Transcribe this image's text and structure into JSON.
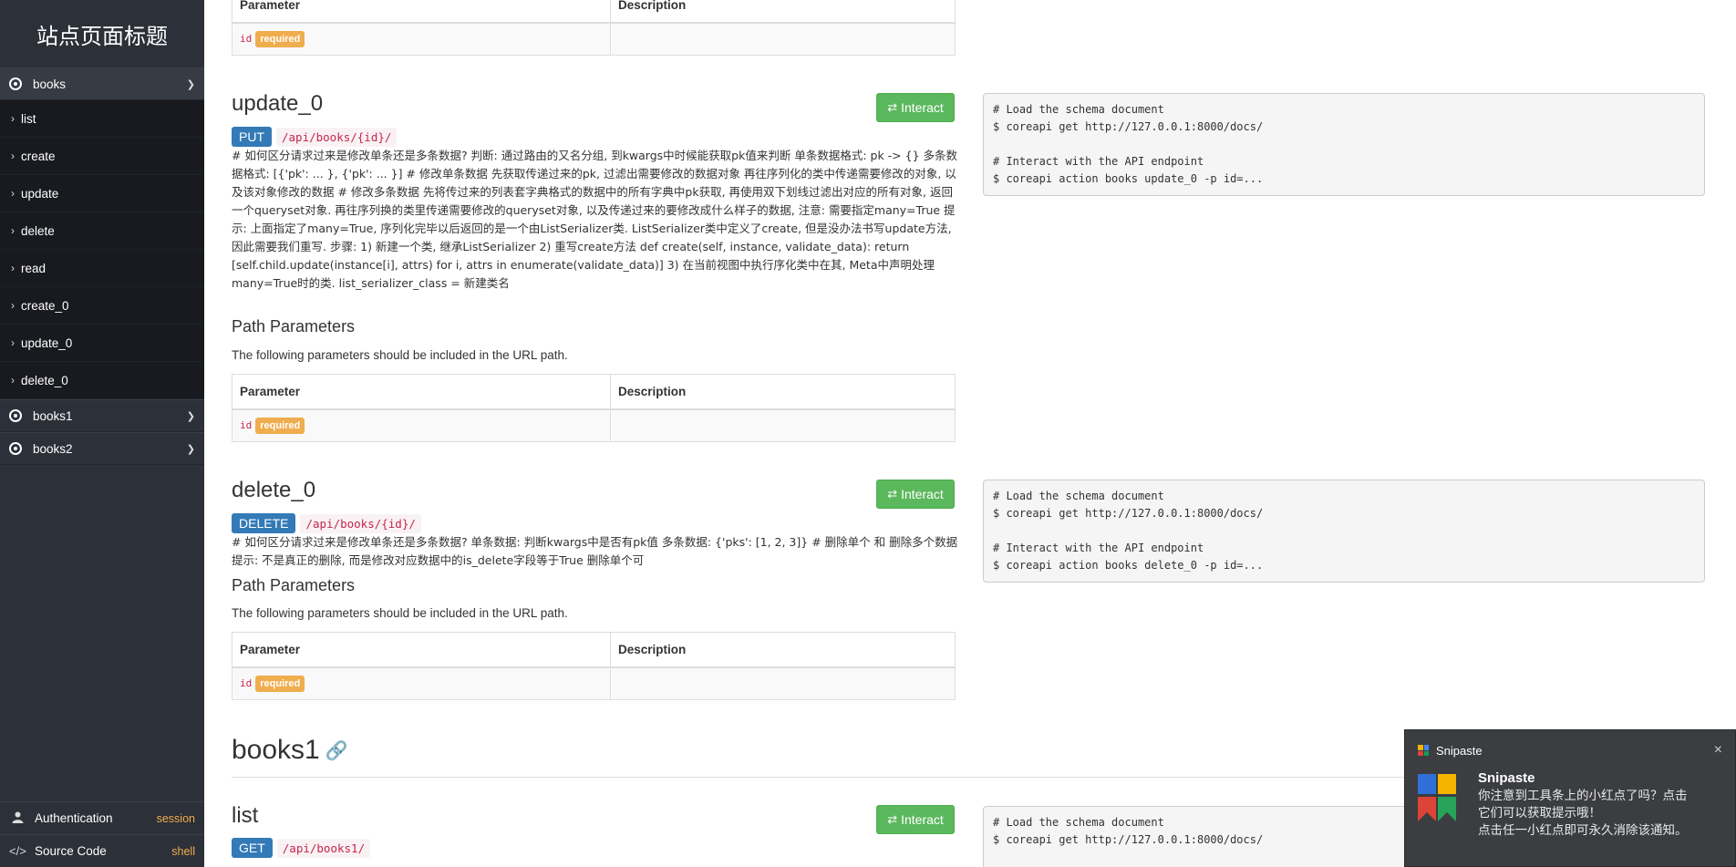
{
  "site_title": "站点页面标题",
  "sidebar": {
    "groups": [
      {
        "label": "books",
        "expanded": true
      },
      {
        "label": "books1",
        "expanded": false
      },
      {
        "label": "books2",
        "expanded": false
      }
    ],
    "books_items": [
      "list",
      "create",
      "update",
      "delete",
      "read",
      "create_0",
      "update_0",
      "delete_0"
    ],
    "bottom": {
      "auth_label": "Authentication",
      "auth_value": "session",
      "source_label": "Source Code",
      "source_value": "shell"
    }
  },
  "table": {
    "header_param": "Parameter",
    "header_desc": "Description",
    "param_name": "id",
    "required_label": "required"
  },
  "common": {
    "interact_label": "Interact",
    "path_params_title": "Path Parameters",
    "path_params_note": "The following parameters should be included in the URL path."
  },
  "update_0": {
    "title": "update_0",
    "method": "PUT",
    "path": "/api/books/{id}/",
    "description": "# 如何区分请求过来是修改单条还是多条数据? 判断: 通过路由的又名分组, 到kwargs中时候能获取pk值来判断 单条数据格式: pk -> {} 多条数据格式: [{'pk': ... }, {'pk': ... }] # 修改单条数据 先获取传递过来的pk, 过滤出需要修改的数据对象 再往序列化的类中传递需要修改的对象, 以及该对象修改的数据 # 修改多条数据 先将传过来的列表套字典格式的数据中的所有字典中pk获取, 再使用双下划线过滤出对应的所有对象, 返回一个queryset对象. 再往序列换的类里传递需要修改的queryset对象, 以及传递过来的要修改成什么样子的数据, 注意: 需要指定many=True 提示: 上面指定了many=True, 序列化完毕以后返回的是一个由ListSerializer类. ListSerializer类中定义了create, 但是没办法书写update方法, 因此需要我们重写. 步骤: 1) 新建一个类, 继承ListSerializer 2) 重写create方法 def create(self, instance, validate_data): return [self.child.update(instance[i], attrs) for i, attrs in enumerate(validate_data)] 3) 在当前视图中执行序化类中在其, Meta中声明处理many=True时的类. list_serializer_class = 新建类名",
    "code": "# Load the schema document\n$ coreapi get http://127.0.0.1:8000/docs/\n\n# Interact with the API endpoint\n$ coreapi action books update_0 -p id=..."
  },
  "delete_0": {
    "title": "delete_0",
    "method": "DELETE",
    "path": "/api/books/{id}/",
    "description": "# 如何区分请求过来是修改单条还是多条数据? 单条数据: 判断kwargs中是否有pk值 多条数据: {'pks': [1, 2, 3]} # 删除单个 和 删除多个数据 提示: 不是真正的删除, 而是修改对应数据中的is_delete字段等于True 删除单个可",
    "code": "# Load the schema document\n$ coreapi get http://127.0.0.1:8000/docs/\n\n# Interact with the API endpoint\n$ coreapi action books delete_0 -p id=..."
  },
  "books1": {
    "section_title": "books1",
    "list_title": "list",
    "method": "GET",
    "path": "/api/books1/",
    "code": "# Load the schema document\n$ coreapi get http://127.0.0.1:8000/docs/"
  },
  "toast": {
    "app": "Snipaste",
    "title": "Snipaste",
    "line1": "你注意到工具条上的小红点了吗？点击",
    "line2": "它们可以获取提示哦！",
    "line3": "点击任一小红点即可永久消除该通知。",
    "close": "×"
  }
}
